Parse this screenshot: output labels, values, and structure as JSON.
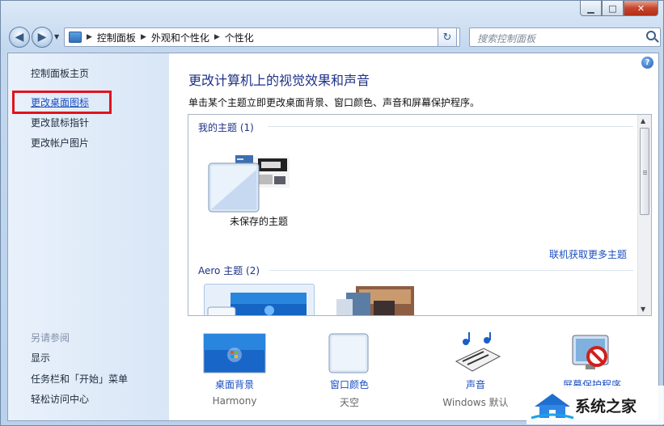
{
  "window": {
    "minimize_glyph": "▁",
    "maximize_glyph": "□",
    "close_glyph": "✕"
  },
  "nav": {
    "back_glyph": "◀",
    "forward_glyph": "▶",
    "breadcrumb": [
      "控制面板",
      "外观和个性化",
      "个性化"
    ],
    "refresh_glyph": "↻",
    "search_placeholder": "搜索控制面板"
  },
  "sidebar": {
    "home": "控制面板主页",
    "links": [
      "更改桌面图标",
      "更改鼠标指针",
      "更改帐户图片"
    ],
    "see_also_head": "另请参阅",
    "see_also": [
      "显示",
      "任务栏和「开始」菜单",
      "轻松访问中心"
    ]
  },
  "main": {
    "title": "更改计算机上的视觉效果和声音",
    "description": "单击某个主题立即更改桌面背景、窗口颜色、声音和屏幕保护程序。",
    "my_themes_head": "我的主题 (1)",
    "unsaved_theme": "未保存的主题",
    "online_link": "联机获取更多主题",
    "aero_head": "Aero 主题 (2)"
  },
  "shortcuts": [
    {
      "label": "桌面背景",
      "sub": "Harmony",
      "icon": "desktop-background-icon"
    },
    {
      "label": "窗口颜色",
      "sub": "天空",
      "icon": "window-color-icon"
    },
    {
      "label": "声音",
      "sub": "Windows 默认",
      "icon": "sound-icon"
    },
    {
      "label": "屏幕保护程序",
      "sub": "",
      "icon": "screensaver-icon"
    }
  ],
  "watermark": "系统之家",
  "colors": {
    "link": "#1a4ec0",
    "title": "#1e3287",
    "highlight_box": "#e0141e"
  }
}
